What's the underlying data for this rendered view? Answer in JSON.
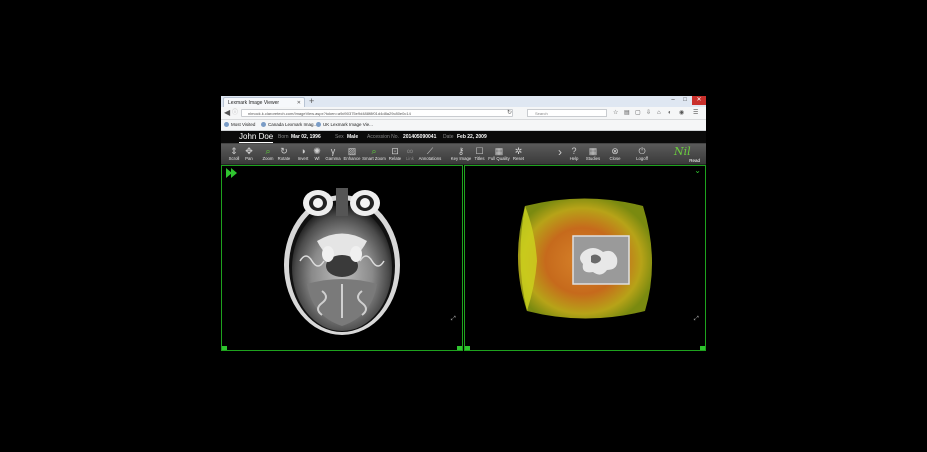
{
  "browser": {
    "tab_title": "Lexmark Image Viewer",
    "url": "nlmock.k.claroretech.com/ImageView.aspx?token=a9d90375e9d488f8f01d4d8a29c80e0c14",
    "search_placeholder": "Search",
    "bookmarks": [
      "Most Visited",
      "Canada Lexmark Imag...",
      "UK Lexmark Image Vie..."
    ]
  },
  "patient": {
    "name": "John Doe",
    "born_label": "Born",
    "born": "Mar 02, 1996",
    "sex_label": "Sex",
    "sex": "Male",
    "accession_label": "Accession No.",
    "accession": "201405090041",
    "date_label": "Date",
    "date": "Feb 22, 2009"
  },
  "toolbar": {
    "tools": [
      {
        "id": "scroll",
        "label": "Scroll",
        "icon": "scroll-icon"
      },
      {
        "id": "pan",
        "label": "Pan",
        "icon": "pan-icon"
      },
      {
        "id": "zoom",
        "label": "Zoom",
        "icon": "zoom-icon"
      },
      {
        "id": "rotate",
        "label": "Rotate",
        "icon": "rotate-icon"
      },
      {
        "id": "invert",
        "label": "Invert",
        "icon": "invert-icon"
      },
      {
        "id": "wl",
        "label": "Wl",
        "icon": "window-level-icon"
      },
      {
        "id": "gamma",
        "label": "Gamma",
        "icon": "gamma-icon"
      },
      {
        "id": "enhance",
        "label": "Enhance",
        "icon": "enhance-icon"
      },
      {
        "id": "smart-zoom",
        "label": "Smart Zoom",
        "icon": "smart-zoom-icon"
      },
      {
        "id": "relate",
        "label": "Relate",
        "icon": "relate-icon"
      },
      {
        "id": "link",
        "label": "Link",
        "icon": "link-icon"
      },
      {
        "id": "annotations",
        "label": "Annotations",
        "icon": "annotation-icon"
      },
      {
        "id": "key-image",
        "label": "Key Image",
        "icon": "key-image-icon"
      },
      {
        "id": "titles",
        "label": "Titles",
        "icon": "titles-icon"
      },
      {
        "id": "full-quality",
        "label": "Full Quality",
        "icon": "full-quality-icon"
      },
      {
        "id": "reset",
        "label": "Reset",
        "icon": "reset-icon"
      },
      {
        "id": "help",
        "label": "Help",
        "icon": "help-icon"
      },
      {
        "id": "studies",
        "label": "Studies",
        "icon": "studies-icon"
      },
      {
        "id": "close",
        "label": "Close",
        "icon": "close-icon"
      },
      {
        "id": "logoff",
        "label": "Logoff",
        "icon": "power-icon"
      }
    ],
    "logo_text": "Nil",
    "logo_sub": "Read"
  },
  "colors": {
    "accent_green": "#2fc42f",
    "toolbar_bg": "#4a4a4a",
    "header_bg": "#0a0a0a"
  }
}
